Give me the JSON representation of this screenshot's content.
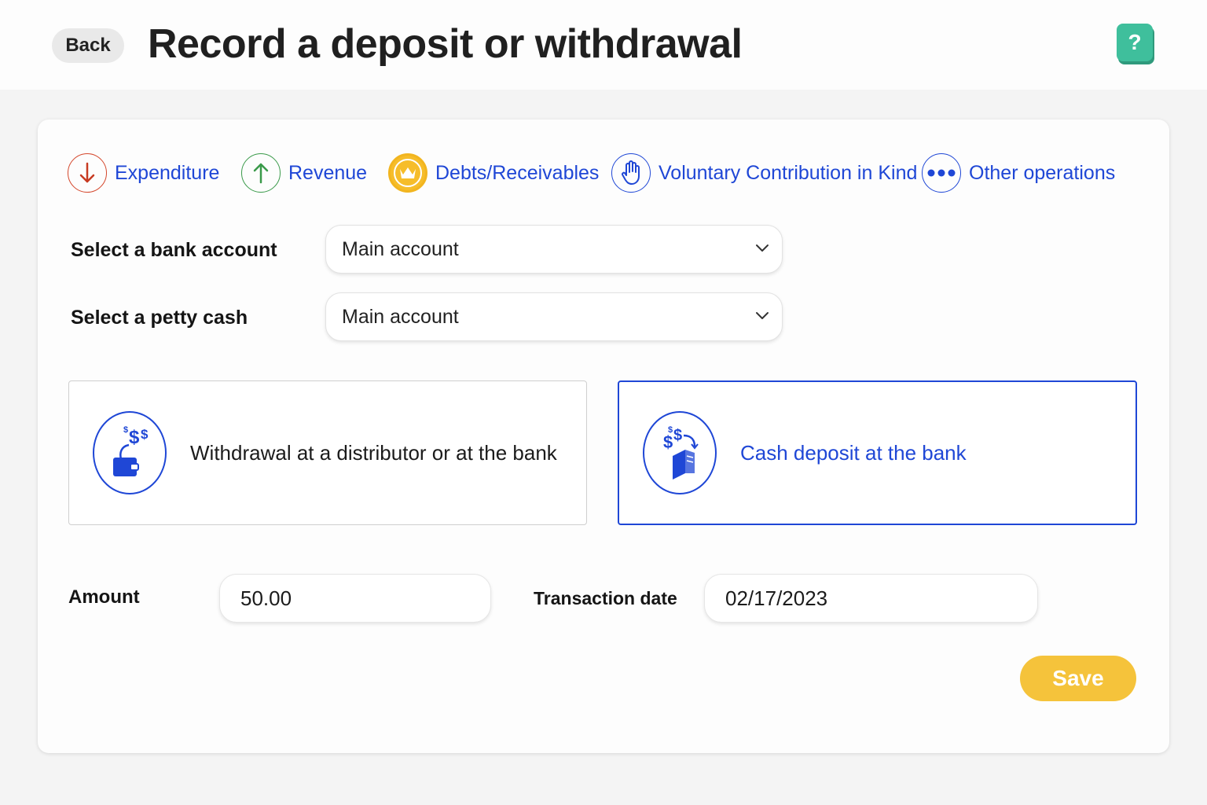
{
  "header": {
    "back_label": "Back",
    "title": "Record a deposit or withdrawal",
    "help_label": "?",
    "help_color": "#3fbf9c"
  },
  "operation_tabs": [
    {
      "label": "Expenditure",
      "icon": "arrow-down-icon",
      "color": "#d4462b"
    },
    {
      "label": "Revenue",
      "icon": "arrow-up-icon",
      "color": "#3a9a4a"
    },
    {
      "label": "Debts/Receivables",
      "icon": "crown-icon",
      "color": "#f2b51f"
    },
    {
      "label": "Voluntary Contribution in Kind",
      "icon": "hand-icon",
      "color": "#1f47d6"
    },
    {
      "label": "Other operations",
      "icon": "more-dots-icon",
      "color": "#1f47d6"
    }
  ],
  "form": {
    "bank_account": {
      "label": "Select a bank account",
      "value": "Main account"
    },
    "petty_cash": {
      "label": "Select a petty cash",
      "value": "Main account"
    },
    "amount": {
      "label": "Amount",
      "value": "50.00"
    },
    "transaction_date": {
      "label": "Transaction date",
      "value": "02/17/2023"
    }
  },
  "operation_types": [
    {
      "label": "Withdrawal at a distributor or at the bank",
      "icon": "wallet-withdrawal-icon",
      "selected": false
    },
    {
      "label": "Cash deposit at the bank",
      "icon": "cash-deposit-icon",
      "selected": true
    }
  ],
  "save_label": "Save",
  "colors": {
    "accent": "#1f47d6",
    "save": "#f5c33b"
  }
}
